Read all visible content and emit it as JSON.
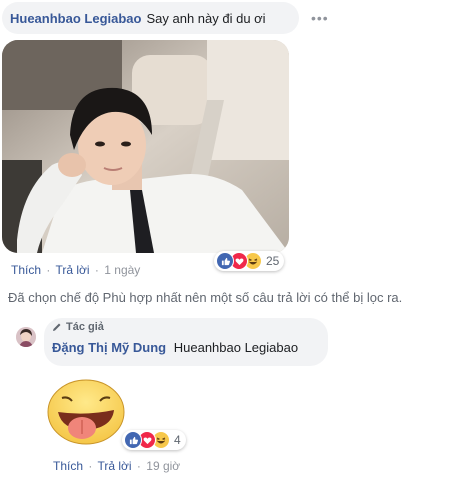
{
  "comment": {
    "author": "Hueanhbao Legiabao",
    "text": "Say anh này đi du ơi",
    "more": "•••",
    "like": "Thích",
    "reply": "Trả lời",
    "time": "1 ngày",
    "reaction_count": "25",
    "reactions": [
      "like-icon",
      "love-icon",
      "haha-icon"
    ]
  },
  "filter_notice": "Đã chọn chế độ Phù hợp nhất nên một số câu trả lời có thể bị lọc ra.",
  "reply": {
    "badge": "Tác giả",
    "author": "Đặng Thị Mỹ Dung",
    "tag": "Hueanhbao Legiabao",
    "like": "Thích",
    "reply": "Trả lời",
    "time": "19 giờ",
    "reaction_count": "4",
    "reactions": [
      "like-icon",
      "love-icon",
      "haha-icon"
    ]
  },
  "colors": {
    "link": "#385898",
    "bubble": "#f2f3f5",
    "meta": "#90949c",
    "like": "#4267b2",
    "love": "#f0284a",
    "haha": "#f7c84b"
  }
}
